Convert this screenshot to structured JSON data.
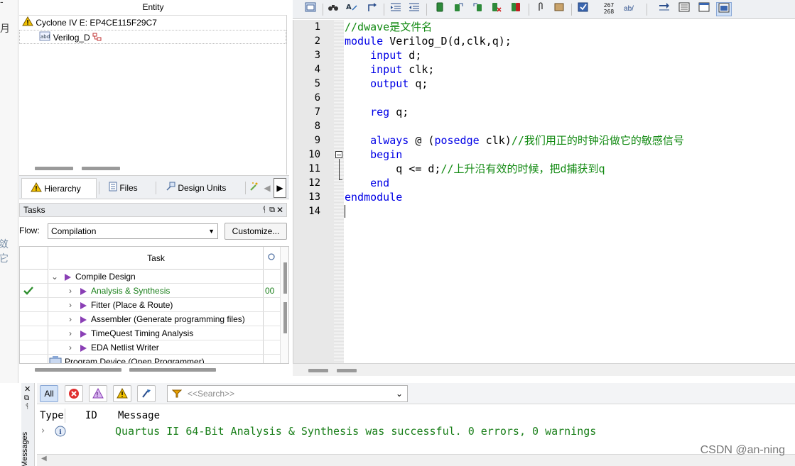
{
  "left_strip": {
    "fragments": [
      "-",
      "月",
      "敛它"
    ]
  },
  "navigator": {
    "header": "Entity",
    "device": "Cyclone IV E: EP4CE115F29C7",
    "top_entity": "Verilog_D",
    "tabs": [
      "Hierarchy",
      "Files",
      "Design Units"
    ]
  },
  "tasks": {
    "title": "Tasks",
    "flow_label": "Flow:",
    "flow_value": "Compilation",
    "customize_label": "Customize...",
    "column_task": "Task",
    "rows": [
      {
        "label": "Compile Design",
        "level": 0,
        "expanded": true,
        "done": false,
        "status": ""
      },
      {
        "label": "Analysis & Synthesis",
        "level": 1,
        "expanded": false,
        "done": true,
        "status": "00"
      },
      {
        "label": "Fitter (Place & Route)",
        "level": 1,
        "expanded": false,
        "done": false,
        "status": ""
      },
      {
        "label": "Assembler (Generate programming files)",
        "level": 1,
        "expanded": false,
        "done": false,
        "status": ""
      },
      {
        "label": "TimeQuest Timing Analysis",
        "level": 1,
        "expanded": false,
        "done": false,
        "status": ""
      },
      {
        "label": "EDA Netlist Writer",
        "level": 1,
        "expanded": false,
        "done": false,
        "status": ""
      },
      {
        "label": "Program Device (Open Programmer)",
        "level": 0,
        "expanded": false,
        "done": false,
        "status": ""
      }
    ]
  },
  "editor": {
    "toolbar_counter_top": "267",
    "toolbar_counter_bottom": "268",
    "toolbar_text": "ab/",
    "line_numbers": [
      "1",
      "2",
      "3",
      "4",
      "5",
      "6",
      "7",
      "8",
      "9",
      "10",
      "11",
      "12",
      "13",
      "14"
    ],
    "lines": [
      [
        {
          "t": "//dwave是文件名",
          "c": "cm"
        }
      ],
      [
        {
          "t": "module",
          "c": "kw"
        },
        {
          "t": " Verilog_D(d,clk,q);",
          "c": ""
        }
      ],
      [
        {
          "t": "    ",
          "c": ""
        },
        {
          "t": "input",
          "c": "kw"
        },
        {
          "t": " d;",
          "c": ""
        }
      ],
      [
        {
          "t": "    ",
          "c": ""
        },
        {
          "t": "input",
          "c": "kw"
        },
        {
          "t": " clk;",
          "c": ""
        }
      ],
      [
        {
          "t": "    ",
          "c": ""
        },
        {
          "t": "output",
          "c": "kw"
        },
        {
          "t": " q;",
          "c": ""
        }
      ],
      [
        {
          "t": "",
          "c": ""
        }
      ],
      [
        {
          "t": "    ",
          "c": ""
        },
        {
          "t": "reg",
          "c": "kw"
        },
        {
          "t": " q;",
          "c": ""
        }
      ],
      [
        {
          "t": "",
          "c": ""
        }
      ],
      [
        {
          "t": "    ",
          "c": ""
        },
        {
          "t": "always",
          "c": "kw"
        },
        {
          "t": " @ (",
          "c": ""
        },
        {
          "t": "posedge",
          "c": "kw"
        },
        {
          "t": " clk)",
          "c": ""
        },
        {
          "t": "//我们用正的时钟沿做它的敏感信号",
          "c": "cm"
        }
      ],
      [
        {
          "t": "    ",
          "c": ""
        },
        {
          "t": "begin",
          "c": "kw"
        }
      ],
      [
        {
          "t": "        q <= d;",
          "c": ""
        },
        {
          "t": "//上升沿有效的时候，把d捕获到q",
          "c": "cm"
        }
      ],
      [
        {
          "t": "    ",
          "c": ""
        },
        {
          "t": "end",
          "c": "kw"
        }
      ],
      [
        {
          "t": "endmodule",
          "c": "kw"
        }
      ],
      [
        {
          "t": "",
          "c": ""
        }
      ]
    ]
  },
  "messages": {
    "side_label": "Messages",
    "filter_all": "All",
    "search_placeholder": "<<Search>>",
    "col_type": "Type",
    "col_id": "ID",
    "col_message": "Message",
    "row_text": "Quartus II 64-Bit Analysis & Synthesis was successful. 0 errors, 0 warnings"
  },
  "watermark": "CSDN @an-ning",
  "colors": {
    "keyword": "#0000e6",
    "comment": "#128a12",
    "success": "#1a7f1a",
    "task_arrow": "#8a3fb5"
  }
}
